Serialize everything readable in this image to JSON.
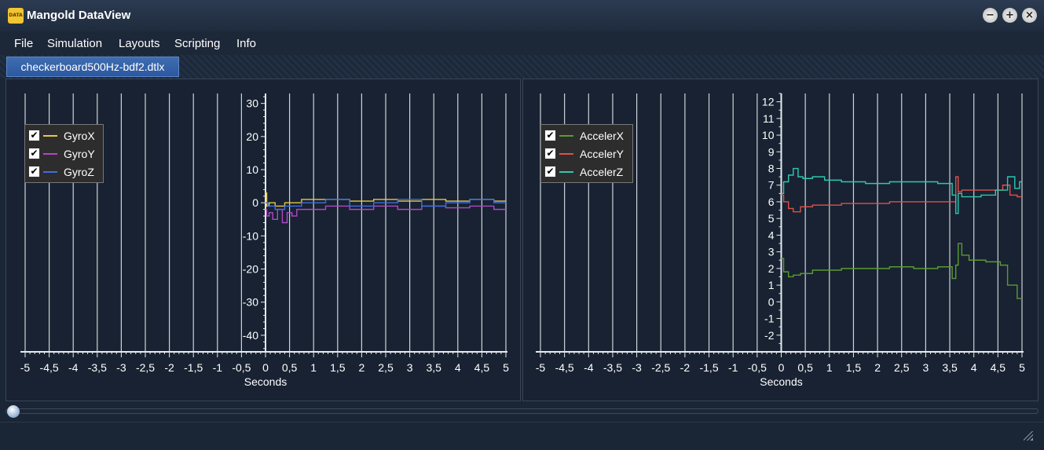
{
  "window": {
    "title": "Mangold DataView",
    "icon": "dataview-app-icon",
    "icon_text": "DATA VIEW",
    "buttons": {
      "minimize": "−",
      "maximize": "+",
      "close": "×"
    }
  },
  "menu": {
    "items": [
      "File",
      "Simulation",
      "Layouts",
      "Scripting",
      "Info"
    ]
  },
  "tabs": [
    {
      "label": "checkerboard500Hz-bdf2.dtlx",
      "active": true
    }
  ],
  "colors": {
    "background": "#1a2535",
    "grid": "#cfd3d8",
    "gyro_x": "#e8c84a",
    "gyro_y": "#b048c8",
    "gyro_z": "#3e6ee0",
    "accel_x": "#5a9a30",
    "accel_y": "#e0504a",
    "accel_z": "#2ec8b0"
  },
  "charts": [
    {
      "legend": [
        {
          "label": "GyroX",
          "checked": true,
          "color": "#e8c84a"
        },
        {
          "label": "GyroY",
          "checked": true,
          "color": "#b048c8"
        },
        {
          "label": "GyroZ",
          "checked": true,
          "color": "#3e6ee0"
        }
      ],
      "xlabel": "Seconds"
    },
    {
      "legend": [
        {
          "label": "AccelerX",
          "checked": true,
          "color": "#5a9a30"
        },
        {
          "label": "AccelerY",
          "checked": true,
          "color": "#e0504a"
        },
        {
          "label": "AccelerZ",
          "checked": true,
          "color": "#2ec8b0"
        }
      ],
      "xlabel": "Seconds"
    }
  ],
  "chart_data": [
    {
      "type": "line",
      "xlabel": "Seconds",
      "ylabel": "",
      "xlim": [
        -5,
        5
      ],
      "ylim": [
        -45,
        33
      ],
      "xticks": [
        "-5",
        "-4,5",
        "-4",
        "-3,5",
        "-3",
        "-2,5",
        "-2",
        "-1,5",
        "-1",
        "-0,5",
        "0",
        "0,5",
        "1",
        "1,5",
        "2",
        "2,5",
        "3",
        "3,5",
        "4",
        "4,5",
        "5"
      ],
      "yticks": [
        30,
        20,
        10,
        0,
        -10,
        -20,
        -30,
        -40
      ],
      "grid": true,
      "legend_position": "top-left",
      "series": [
        {
          "name": "GyroX",
          "x": [
            0,
            0.05,
            0.1,
            0.3,
            0.5,
            1,
            1.5,
            2,
            2.5,
            3,
            3.5,
            4,
            4.5,
            5
          ],
          "y": [
            3,
            -1,
            0,
            -1,
            0,
            1,
            1,
            0.5,
            1,
            0.5,
            1,
            0.5,
            1,
            0.5
          ]
        },
        {
          "name": "GyroY",
          "x": [
            0,
            0.05,
            0.1,
            0.2,
            0.3,
            0.4,
            0.5,
            0.6,
            0.7,
            1,
            1.5,
            2,
            2.5,
            3,
            3.5,
            4,
            4.5,
            5
          ],
          "y": [
            -2,
            -4,
            -3,
            -5,
            -2,
            -6,
            -3,
            -4,
            -2,
            -2,
            -1,
            -2,
            -1,
            -2,
            -1,
            -1.5,
            -1,
            -2
          ]
        },
        {
          "name": "GyroZ",
          "x": [
            0,
            0.1,
            0.3,
            0.5,
            1,
            1.5,
            2,
            2.5,
            3,
            3.5,
            4,
            4.5,
            5
          ],
          "y": [
            0,
            -1,
            -2,
            -1,
            0,
            1,
            -1,
            0,
            1,
            -1,
            0,
            1,
            0
          ]
        }
      ]
    },
    {
      "type": "line",
      "xlabel": "Seconds",
      "ylabel": "",
      "xlim": [
        -5,
        5
      ],
      "ylim": [
        -3,
        12.5
      ],
      "xticks": [
        "-5",
        "-4,5",
        "-4",
        "-3,5",
        "-3",
        "-2,5",
        "-2",
        "-1,5",
        "-1",
        "-0,5",
        "0",
        "0,5",
        "1",
        "1,5",
        "2",
        "2,5",
        "3",
        "3,5",
        "4",
        "4,5",
        "5"
      ],
      "yticks": [
        12,
        11,
        10,
        9,
        8,
        7,
        6,
        5,
        4,
        3,
        2,
        1,
        0,
        -1,
        -2
      ],
      "grid": true,
      "legend_position": "top-left",
      "series": [
        {
          "name": "AccelerX",
          "x": [
            0,
            0.1,
            0.2,
            0.3,
            0.5,
            0.8,
            1,
            1.5,
            2,
            2.5,
            3,
            3.5,
            3.6,
            3.65,
            3.7,
            3.8,
            4,
            4.5,
            4.6,
            4.8,
            5
          ],
          "y": [
            2.6,
            1.8,
            1.5,
            1.6,
            1.7,
            1.9,
            1.9,
            2,
            2,
            2.1,
            2,
            2.1,
            1.4,
            2.2,
            3.5,
            2.8,
            2.5,
            2.4,
            2.2,
            1,
            0.2
          ]
        },
        {
          "name": "AccelerY",
          "x": [
            0,
            0.1,
            0.2,
            0.3,
            0.5,
            0.8,
            1,
            1.5,
            2,
            2.5,
            3,
            3.5,
            3.6,
            3.65,
            3.7,
            3.8,
            4,
            4.5,
            4.7,
            4.8,
            5
          ],
          "y": [
            6.4,
            6,
            5.6,
            5.4,
            5.7,
            5.8,
            5.8,
            5.9,
            5.9,
            6,
            6,
            6,
            6,
            7.5,
            6.6,
            6.7,
            6.7,
            6.7,
            7,
            6.4,
            6.3
          ]
        },
        {
          "name": "AccelerZ",
          "x": [
            0,
            0.1,
            0.2,
            0.3,
            0.4,
            0.5,
            0.8,
            1,
            1.5,
            2,
            2.5,
            3,
            3.5,
            3.6,
            3.65,
            3.7,
            3.8,
            4,
            4.3,
            4.6,
            4.8,
            4.9,
            5
          ],
          "y": [
            6.5,
            7.2,
            7.6,
            8,
            7.5,
            7.4,
            7.5,
            7.3,
            7.2,
            7.1,
            7.2,
            7.2,
            7.1,
            6.4,
            5.3,
            6.5,
            6.3,
            6.3,
            6.4,
            6.7,
            7.5,
            6.8,
            7.2
          ]
        }
      ]
    }
  ],
  "scrubber": {
    "position": 0
  }
}
